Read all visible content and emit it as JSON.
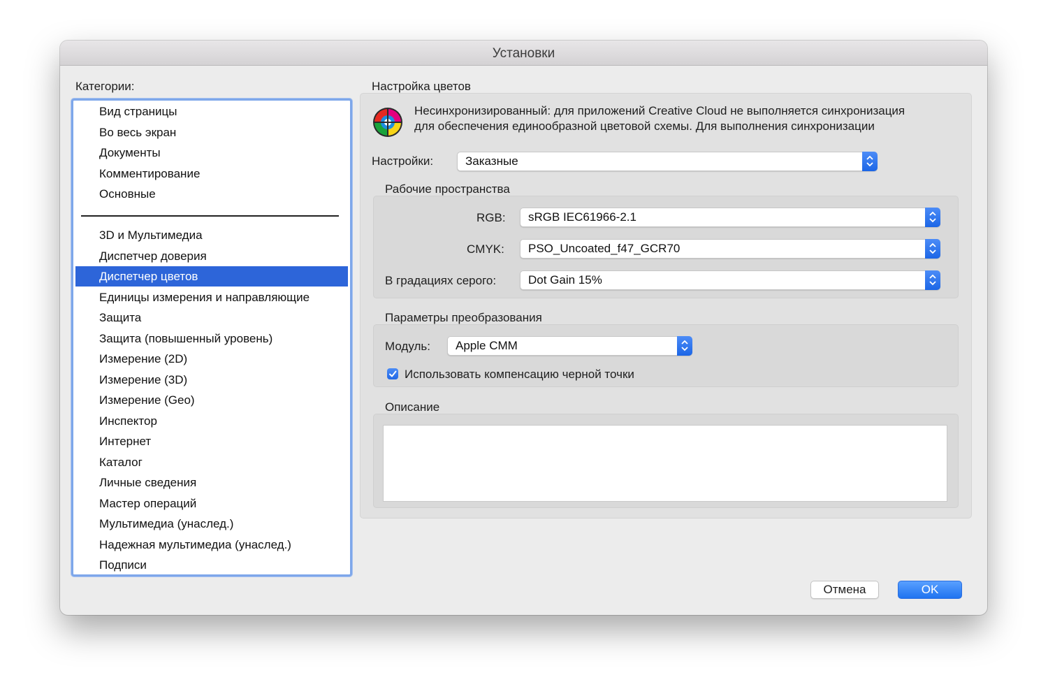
{
  "window": {
    "title": "Установки"
  },
  "categories": {
    "label": "Категории:",
    "group1": [
      "Вид страницы",
      "Во весь экран",
      "Документы",
      "Комментирование",
      "Основные"
    ],
    "group2": [
      "3D и Мультимедиа",
      "Диспетчер доверия",
      "Диспетчер цветов",
      "Единицы измерения и направляющие",
      "Защита",
      "Защита (повышенный уровень)",
      "Измерение (2D)",
      "Измерение (3D)",
      "Измерение (Geo)",
      "Инспектор",
      "Интернет",
      "Каталог",
      "Личные сведения",
      "Мастер операций",
      "Мультимедиа (унаслед.)",
      "Надежная мультимедиа (унаслед.)",
      "Подписи"
    ],
    "selected": "Диспетчер цветов"
  },
  "color_settings": {
    "section_title": "Настройка цветов",
    "icon": "color-management-icon",
    "notice_line1": "Несинхронизированный: для приложений Creative Cloud не выполняется синхронизация",
    "notice_line2": "для обеспечения единообразной цветовой схемы. Для выполнения синхронизации",
    "settings_label": "Настройки:",
    "settings_value": "Заказные"
  },
  "working_spaces": {
    "title": "Рабочие пространства",
    "rgb_label": "RGB:",
    "rgb_value": "sRGB IEC61966-2.1",
    "cmyk_label": "CMYK:",
    "cmyk_value": "PSO_Uncoated_f47_GCR70",
    "gray_label": "В градациях серого:",
    "gray_value": "Dot Gain 15%"
  },
  "conversion": {
    "title": "Параметры преобразования",
    "module_label": "Модуль:",
    "module_value": "Apple CMM",
    "bpc_label": "Использовать компенсацию черной точки",
    "bpc_checked": true
  },
  "description": {
    "title": "Описание",
    "text": ""
  },
  "buttons": {
    "cancel": "Отмена",
    "ok": "OK"
  },
  "colors": {
    "accent": "#2d65d9",
    "selection": "#2d65d9",
    "focus_ring": "#7ea7ea"
  }
}
